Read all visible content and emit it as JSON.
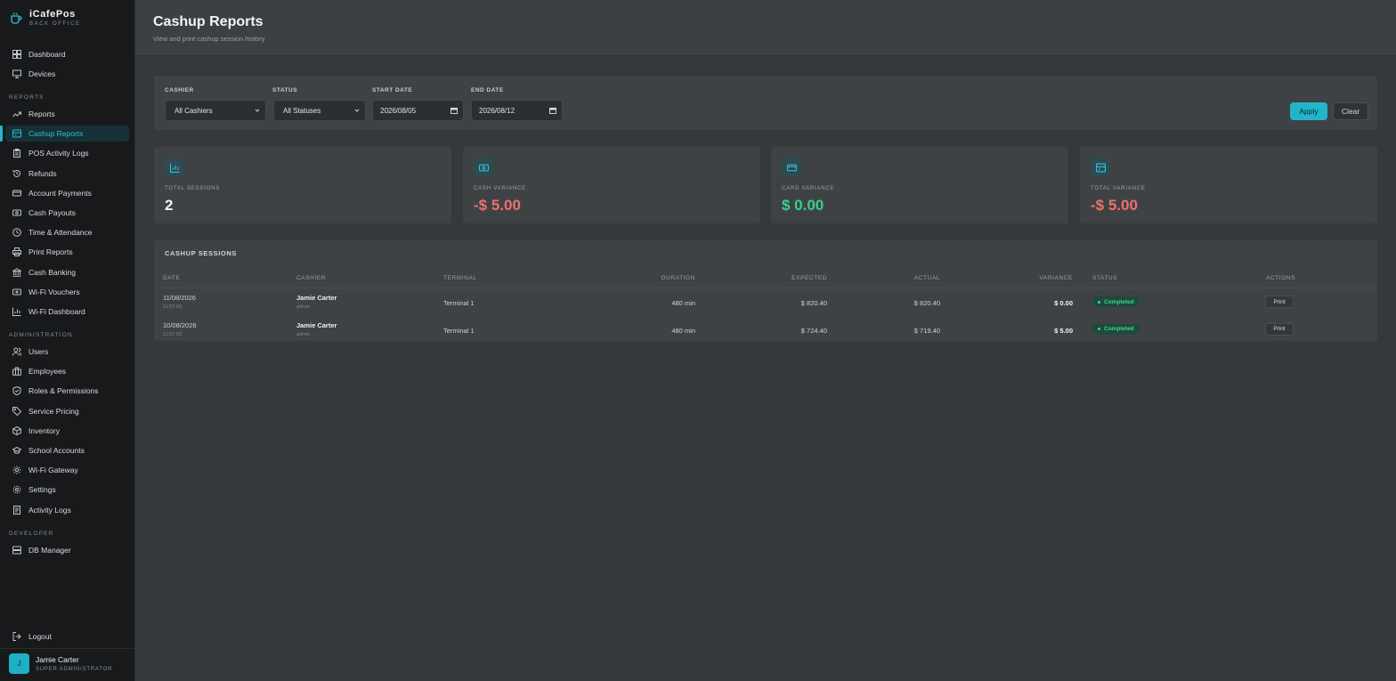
{
  "brand": {
    "title": "iCafePos",
    "subtitle": "BACK OFFICE"
  },
  "sidebar": {
    "top_items": [
      {
        "label": "Dashboard",
        "icon": "dashboard-icon"
      },
      {
        "label": "Devices",
        "icon": "monitor-icon"
      }
    ],
    "sections": [
      {
        "label": "REPORTS"
      },
      {
        "label": "ADMINISTRATION"
      },
      {
        "label": "DEVELOPER"
      }
    ],
    "reports_items": [
      {
        "label": "Reports",
        "icon": "trend-icon"
      },
      {
        "label": "Cashup Reports",
        "icon": "register-icon",
        "active": true
      },
      {
        "label": "POS Activity Logs",
        "icon": "clipboard-icon"
      },
      {
        "label": "Refunds",
        "icon": "history-icon"
      },
      {
        "label": "Account Payments",
        "icon": "card-icon"
      },
      {
        "label": "Cash Payouts",
        "icon": "cash-icon"
      },
      {
        "label": "Time & Attendance",
        "icon": "clock-icon"
      },
      {
        "label": "Print Reports",
        "icon": "printer-icon"
      },
      {
        "label": "Cash Banking",
        "icon": "bank-icon"
      },
      {
        "label": "Wi-Fi Vouchers",
        "icon": "ticket-icon"
      },
      {
        "label": "Wi-Fi Dashboard",
        "icon": "bar-chart-icon"
      }
    ],
    "admin_items": [
      {
        "label": "Users",
        "icon": "users-icon"
      },
      {
        "label": "Employees",
        "icon": "briefcase-icon"
      },
      {
        "label": "Roles & Permissions",
        "icon": "shield-icon"
      },
      {
        "label": "Service Pricing",
        "icon": "tag-icon"
      },
      {
        "label": "Inventory",
        "icon": "box-icon"
      },
      {
        "label": "School Accounts",
        "icon": "graduation-cap-icon"
      },
      {
        "label": "Wi-Fi Gateway",
        "icon": "gear-icon"
      },
      {
        "label": "Settings",
        "icon": "settings-icon"
      },
      {
        "label": "Activity Logs",
        "icon": "logs-icon"
      }
    ],
    "dev_items": [
      {
        "label": "DB Manager",
        "icon": "database-icon"
      }
    ],
    "logout_label": "Logout"
  },
  "user": {
    "initial": "J",
    "name": "Jamie Carter",
    "role": "SUPER ADMINISTRATOR"
  },
  "header": {
    "title": "Cashup Reports",
    "subtitle": "View and print cashup session history"
  },
  "filters": {
    "cashier_label": "CASHIER",
    "cashier_value": "All Cashiers",
    "status_label": "STATUS",
    "status_value": "All Statuses",
    "start_label": "START DATE",
    "start_value": "2026/08/05",
    "end_label": "END DATE",
    "end_value": "2026/08/12",
    "apply_label": "Apply",
    "clear_label": "Clear"
  },
  "stats": [
    {
      "label": "TOTAL SESSIONS",
      "value": "2",
      "color": "#f3f4f5",
      "icon": "bar-chart-icon"
    },
    {
      "label": "CASH VARIANCE",
      "value": "-$ 5.00",
      "color": "#f0706a",
      "icon": "cash-icon"
    },
    {
      "label": "CARD VARIANCE",
      "value": "$ 0.00",
      "color": "#37d08c",
      "icon": "card-icon"
    },
    {
      "label": "TOTAL VARIANCE",
      "value": "-$ 5.00",
      "color": "#f0706a",
      "icon": "register-icon"
    }
  ],
  "table": {
    "title": "CASHUP SESSIONS",
    "columns": [
      "DATE",
      "CASHIER",
      "TERMINAL",
      "DURATION",
      "EXPECTED",
      "ACTUAL",
      "VARIANCE",
      "STATUS",
      "ACTIONS"
    ],
    "rows": [
      {
        "date": "11/08/2026",
        "time": "11:57:03",
        "cashier": "Jamie Carter",
        "role": "admin",
        "terminal": "Terminal 1",
        "duration": "480 min",
        "expected": "$ 820.40",
        "actual": "$ 820.40",
        "variance": "$ 0.00",
        "status": "Completed",
        "action": "Print"
      },
      {
        "date": "10/08/2026",
        "time": "11:57:03",
        "cashier": "Jamie Carter",
        "role": "admin",
        "terminal": "Terminal 1",
        "duration": "480 min",
        "expected": "$ 724.40",
        "actual": "$ 719.40",
        "variance": "$ 5.00",
        "status": "Completed",
        "action": "Print"
      }
    ]
  },
  "colors": {
    "accent": "#22b5c9",
    "negative": "#f0706a",
    "positive": "#37d08c"
  }
}
